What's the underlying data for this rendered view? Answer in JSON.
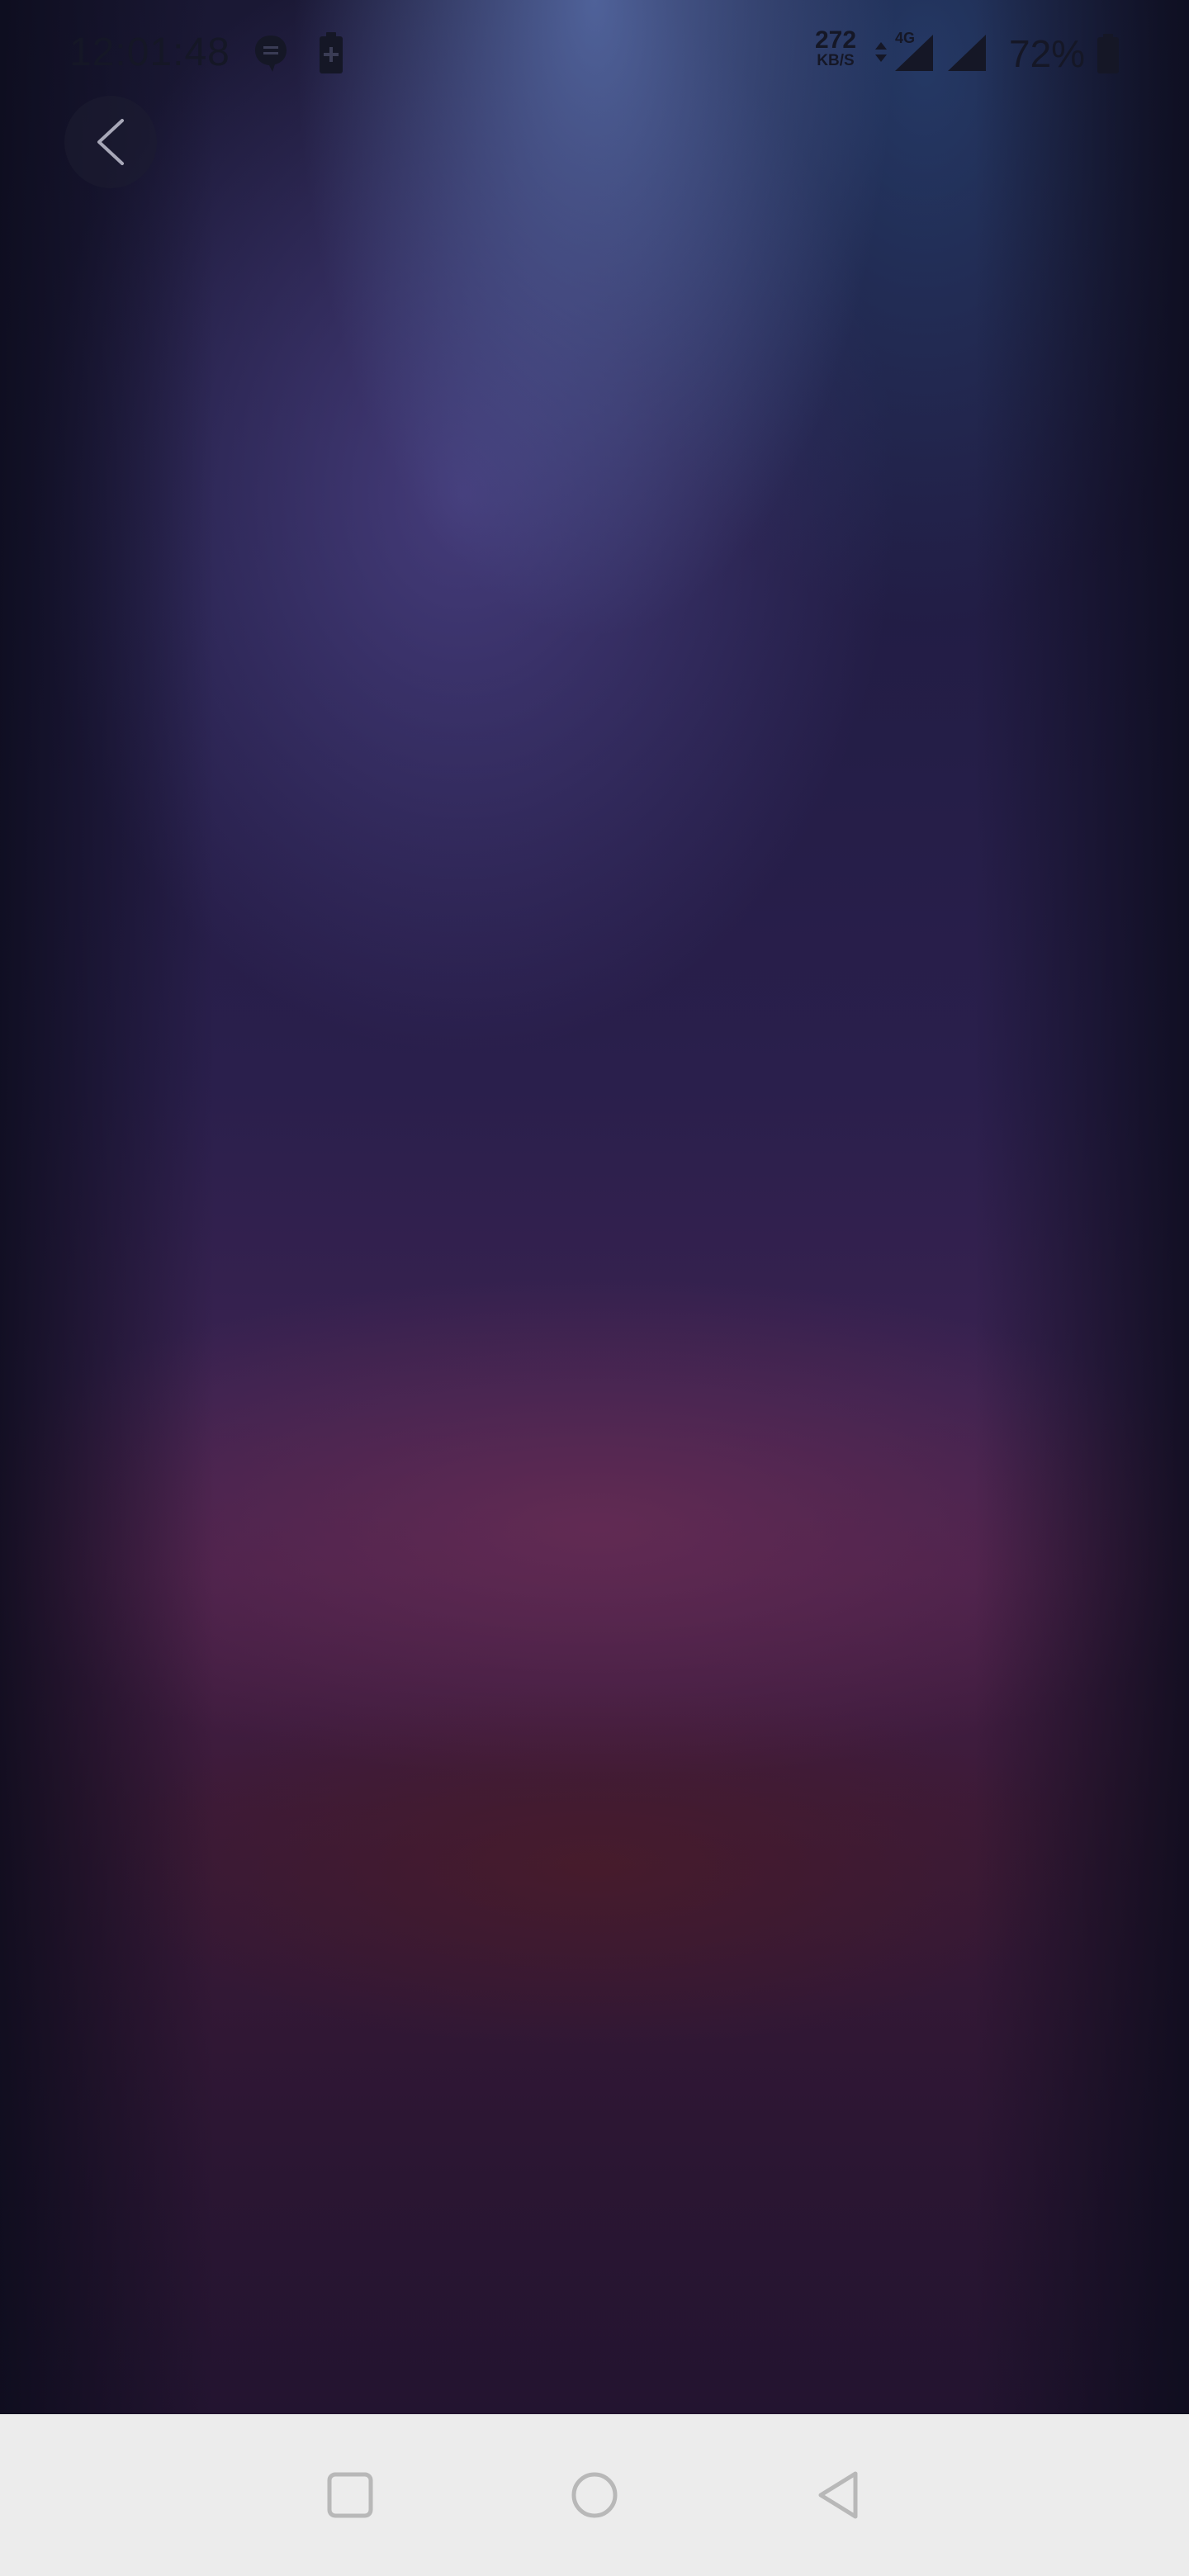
{
  "status_bar": {
    "time": "12:01:48",
    "net_speed_value": "272",
    "net_speed_unit": "KB/S",
    "network_type": "4G",
    "battery_percent": "72%",
    "icons": [
      "message-icon",
      "battery-charging-icon",
      "data-arrows-icon",
      "signal-icon",
      "signal-icon",
      "battery-icon"
    ]
  },
  "top_bar": {
    "back_icon": "chevron-left-icon"
  },
  "nav_bar": {
    "buttons": [
      "recents-icon",
      "home-icon",
      "back-icon"
    ]
  },
  "colors": {
    "status_text": "#151726",
    "nav_bar_bg": "#ececec",
    "nav_icon": "#b8b8b8",
    "wallpaper_top": "#4a5a90",
    "wallpaper_middle": "#2a1f4c",
    "wallpaper_bottom": "#4a2040"
  }
}
